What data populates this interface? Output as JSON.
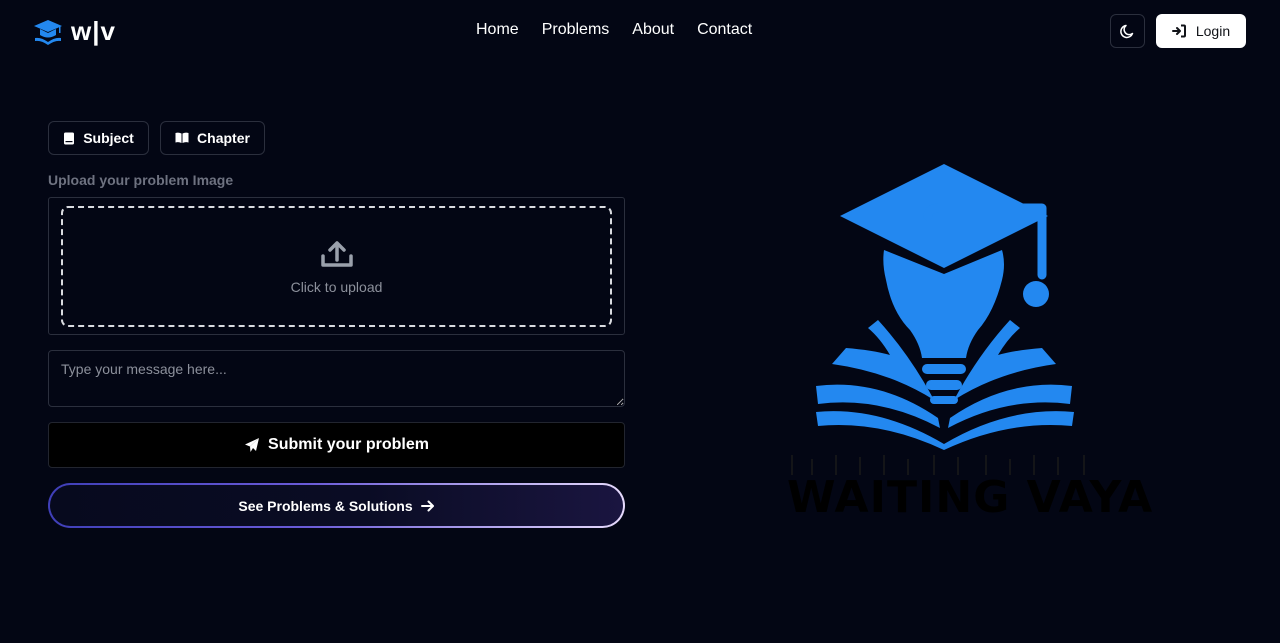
{
  "header": {
    "logo_text": "w|v",
    "nav": [
      {
        "label": "Home"
      },
      {
        "label": "Problems"
      },
      {
        "label": "About"
      },
      {
        "label": "Contact"
      }
    ],
    "login_label": "Login"
  },
  "form": {
    "subject_label": "Subject",
    "chapter_label": "Chapter",
    "upload_label": "Upload your problem Image",
    "upload_prompt": "Click to upload",
    "message_placeholder": "Type your message here...",
    "message_value": "",
    "submit_label": "Submit your problem",
    "see_label": "See Problems & Solutions"
  },
  "brand": {
    "wordmark": "WAITING VAYA",
    "accent": "#2388f0"
  },
  "colors": {
    "background": "#030614",
    "border": "#2b2f3d",
    "muted_text": "#6e7280"
  }
}
